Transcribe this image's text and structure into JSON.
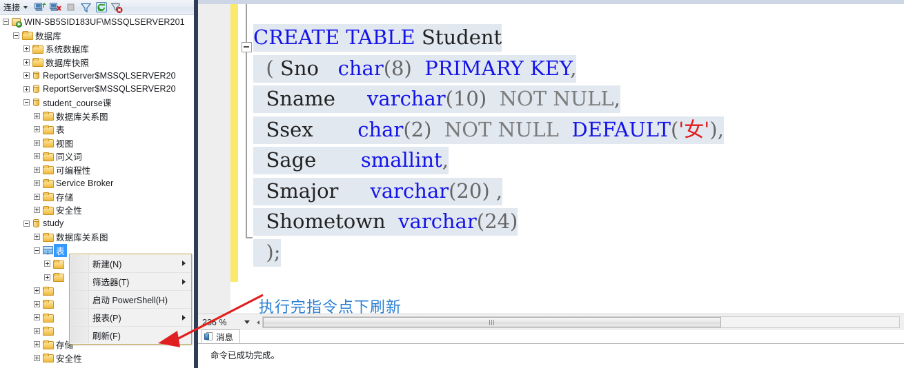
{
  "explorer": {
    "toolbar": {
      "connect_label": "连接",
      "buttons": [
        {
          "name": "connect-dropdown",
          "label": "连接"
        },
        {
          "name": "connect-object-explorer-icon",
          "label": "连接"
        },
        {
          "name": "disconnect-object-explorer-icon",
          "label": "断开连接"
        },
        {
          "name": "stop-icon",
          "label": "停止"
        },
        {
          "name": "filter-icon",
          "label": "筛选器"
        },
        {
          "name": "refresh-icon",
          "label": "刷新"
        },
        {
          "name": "remove-filter-icon",
          "label": "删除筛选器"
        }
      ]
    },
    "tree": [
      {
        "label": "WIN-SB5SID183UF\\MSSQLSERVER201",
        "indent": 0,
        "icon": "server",
        "state": "minus"
      },
      {
        "label": "数据库",
        "indent": 1,
        "icon": "folder",
        "state": "minus"
      },
      {
        "label": "系统数据库",
        "indent": 2,
        "icon": "folder",
        "state": "plus"
      },
      {
        "label": "数据库快照",
        "indent": 2,
        "icon": "folder",
        "state": "plus"
      },
      {
        "label": "ReportServer$MSSQLSERVER20",
        "indent": 2,
        "icon": "db",
        "state": "plus"
      },
      {
        "label": "ReportServer$MSSQLSERVER20",
        "indent": 2,
        "icon": "db",
        "state": "plus"
      },
      {
        "label": "student_course课",
        "indent": 2,
        "icon": "db",
        "state": "minus"
      },
      {
        "label": "数据库关系图",
        "indent": 3,
        "icon": "folder",
        "state": "plus"
      },
      {
        "label": "表",
        "indent": 3,
        "icon": "folder",
        "state": "plus"
      },
      {
        "label": "视图",
        "indent": 3,
        "icon": "folder",
        "state": "plus"
      },
      {
        "label": "同义词",
        "indent": 3,
        "icon": "folder",
        "state": "plus"
      },
      {
        "label": "可编程性",
        "indent": 3,
        "icon": "folder",
        "state": "plus"
      },
      {
        "label": "Service Broker",
        "indent": 3,
        "icon": "folder",
        "state": "plus"
      },
      {
        "label": "存储",
        "indent": 3,
        "icon": "folder",
        "state": "plus"
      },
      {
        "label": "安全性",
        "indent": 3,
        "icon": "folder",
        "state": "plus"
      },
      {
        "label": "study",
        "indent": 2,
        "icon": "db",
        "state": "minus"
      },
      {
        "label": "数据库关系图",
        "indent": 3,
        "icon": "folder",
        "state": "plus"
      },
      {
        "label": "表",
        "indent": 3,
        "icon": "table",
        "state": "minus",
        "selected": true
      },
      {
        "label": "",
        "indent": 4,
        "icon": "folder",
        "state": "plus"
      },
      {
        "label": "",
        "indent": 4,
        "icon": "folder",
        "state": "plus"
      },
      {
        "label": "",
        "indent": 3,
        "icon": "folder",
        "state": "plus"
      },
      {
        "label": "",
        "indent": 3,
        "icon": "folder",
        "state": "plus"
      },
      {
        "label": "",
        "indent": 3,
        "icon": "folder",
        "state": "plus"
      },
      {
        "label": "",
        "indent": 3,
        "icon": "folder",
        "state": "plus"
      },
      {
        "label": "存储",
        "indent": 3,
        "icon": "folder",
        "state": "plus"
      },
      {
        "label": "安全性",
        "indent": 3,
        "icon": "folder",
        "state": "plus"
      }
    ]
  },
  "context_menu": {
    "items": [
      {
        "label": "新建(N)",
        "submenu": true
      },
      {
        "label": "筛选器(T)",
        "submenu": true
      },
      {
        "label": "启动 PowerShell(H)",
        "submenu": false
      },
      {
        "label": "报表(P)",
        "submenu": true
      },
      {
        "label": "刷新(F)",
        "submenu": false
      }
    ]
  },
  "editor": {
    "code_lines": [
      [
        {
          "t": "CREATE TABLE ",
          "c": "kw"
        },
        {
          "t": "Student",
          "c": "id"
        }
      ],
      [
        {
          "t": "  ( ",
          "c": "punc"
        },
        {
          "t": "Sno   ",
          "c": "id"
        },
        {
          "t": "char",
          "c": "ty"
        },
        {
          "t": "(8)",
          "c": "punc"
        },
        {
          "t": "  ",
          "c": "id"
        },
        {
          "t": "PRIMARY KEY",
          "c": "kw"
        },
        {
          "t": ",",
          "c": "punc"
        }
      ],
      [
        {
          "t": "  ",
          "c": "punc"
        },
        {
          "t": "Sname     ",
          "c": "id"
        },
        {
          "t": "varchar",
          "c": "ty"
        },
        {
          "t": "(10)",
          "c": "punc"
        },
        {
          "t": "  ",
          "c": "id"
        },
        {
          "t": "NOT NULL",
          "c": "gry"
        },
        {
          "t": ",",
          "c": "punc"
        }
      ],
      [
        {
          "t": "  ",
          "c": "punc"
        },
        {
          "t": "Ssex       ",
          "c": "id"
        },
        {
          "t": "char",
          "c": "ty"
        },
        {
          "t": "(2)",
          "c": "punc"
        },
        {
          "t": "  ",
          "c": "id"
        },
        {
          "t": "NOT NULL",
          "c": "gry"
        },
        {
          "t": "  ",
          "c": "id"
        },
        {
          "t": "DEFAULT",
          "c": "kw"
        },
        {
          "t": "(",
          "c": "punc"
        },
        {
          "t": "'女'",
          "c": "str"
        },
        {
          "t": "),",
          "c": "punc"
        }
      ],
      [
        {
          "t": "  ",
          "c": "punc"
        },
        {
          "t": "Sage       ",
          "c": "id"
        },
        {
          "t": "smallint",
          "c": "ty"
        },
        {
          "t": ",",
          "c": "punc"
        }
      ],
      [
        {
          "t": "  ",
          "c": "punc"
        },
        {
          "t": "Smajor     ",
          "c": "id"
        },
        {
          "t": "varchar",
          "c": "ty"
        },
        {
          "t": "(20)",
          "c": "punc"
        },
        {
          "t": " ,",
          "c": "punc"
        }
      ],
      [
        {
          "t": "  ",
          "c": "punc"
        },
        {
          "t": "Shometown  ",
          "c": "id"
        },
        {
          "t": "varchar",
          "c": "ty"
        },
        {
          "t": "(24)",
          "c": "punc"
        }
      ],
      [
        {
          "t": "  );",
          "c": "punc"
        }
      ]
    ],
    "annotation": "执行完指令点下刷新",
    "annotation_color": "#2a7fd4",
    "arrow_color": "#e02020",
    "selection_color": "#e2e8f0",
    "changebar_color": "#fbe96c",
    "keyword_color": "#1414e8",
    "string_color": "#e01b1b"
  },
  "zoombar": {
    "zoom_value": "236 %"
  },
  "results": {
    "tab_label": "消息",
    "message": "命令已成功完成。"
  }
}
